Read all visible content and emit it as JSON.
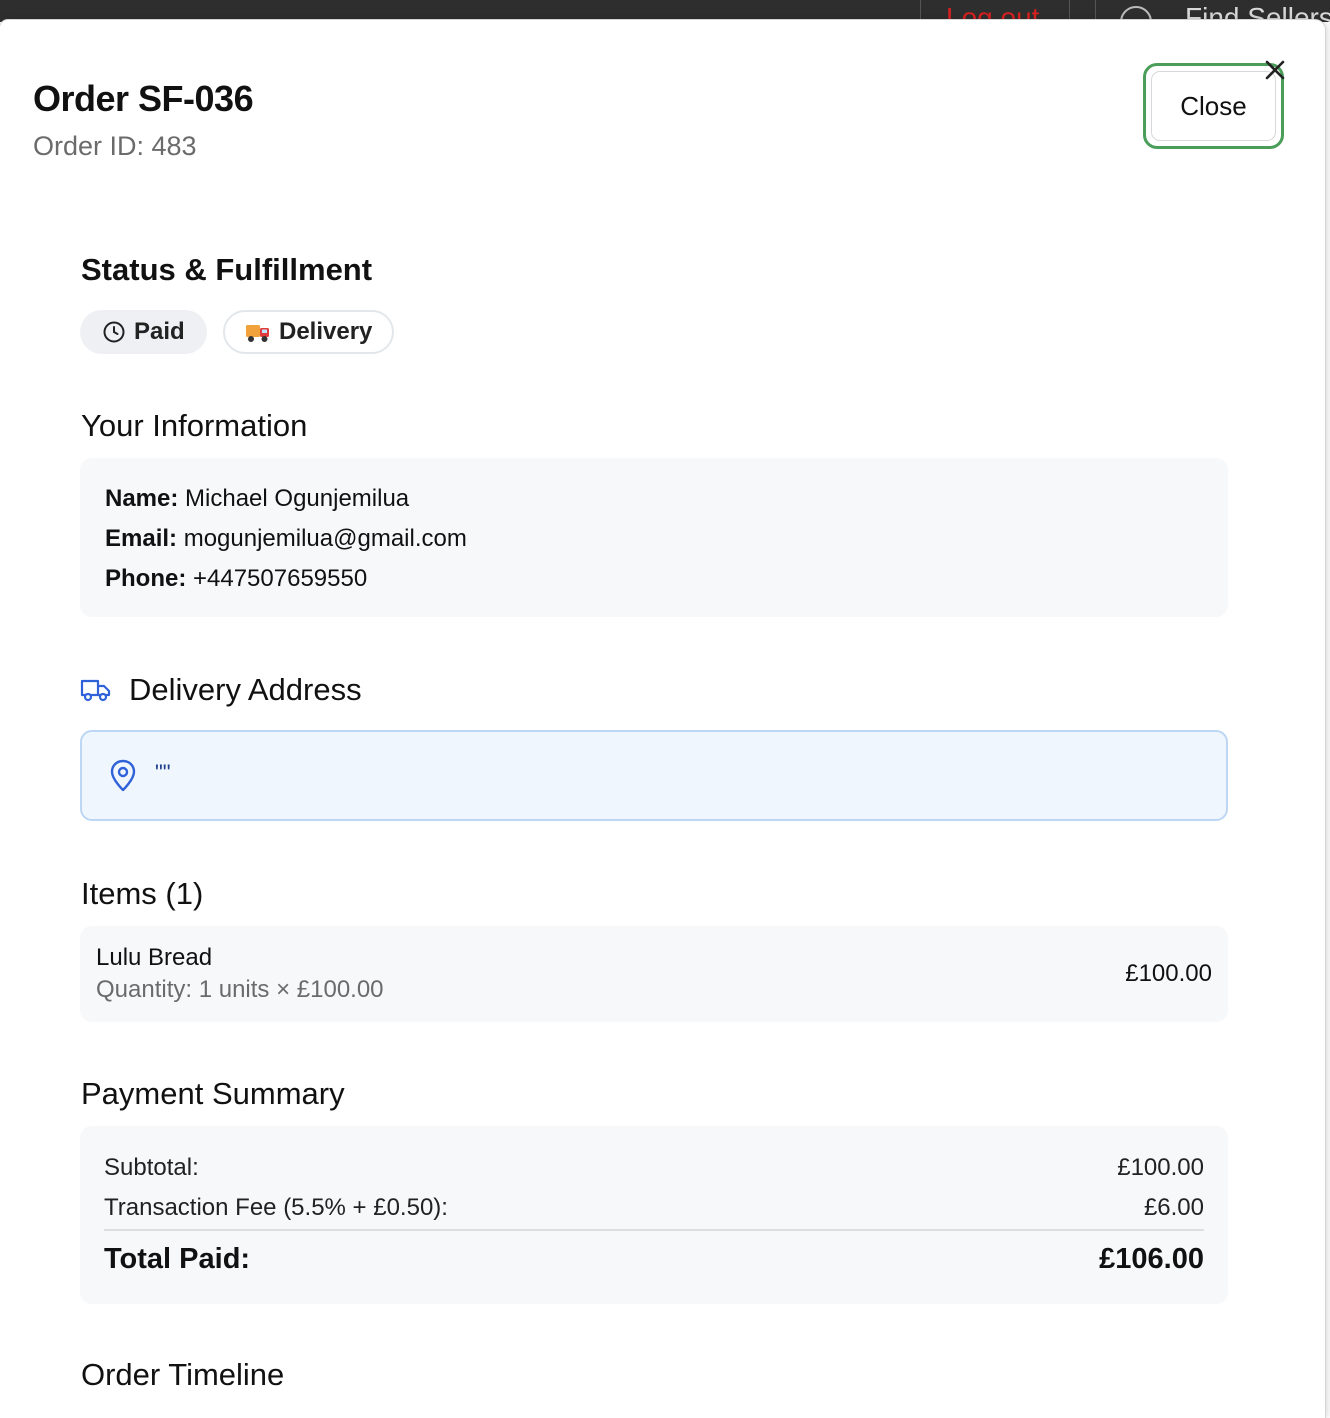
{
  "background_bar": {
    "logout_label": "Log out",
    "search_label": "Find Sellers"
  },
  "modal": {
    "title": "Order SF-036",
    "order_id": "Order ID: 483",
    "close_label": "Close",
    "close_icon": "x-icon"
  },
  "status": {
    "heading": "Status & Fulfillment",
    "payment_badge": "Paid",
    "payment_icon": "clock-icon",
    "fulfillment_badge": "Delivery",
    "fulfillment_icon": "delivery-truck-emoji"
  },
  "your_info": {
    "heading": "Your Information",
    "name_label": "Name:",
    "name_value": "Michael Ogunjemilua",
    "email_label": "Email:",
    "email_value": "mogunjemilua@gmail.com",
    "phone_label": "Phone:",
    "phone_value": "+447507659550"
  },
  "delivery_address": {
    "heading": "Delivery Address",
    "heading_icon": "truck-icon",
    "pin_icon": "map-pin-icon",
    "address": "\"\""
  },
  "items": {
    "heading": "Items (1)",
    "list": [
      {
        "name": "Lulu Bread",
        "quantity_text": "Quantity: 1 units × £100.00",
        "price": "£100.00"
      }
    ]
  },
  "payment_summary": {
    "heading": "Payment Summary",
    "subtotal_label": "Subtotal:",
    "subtotal_value": "£100.00",
    "fee_label": "Transaction Fee (5.5% + £0.50):",
    "fee_value": "£6.00",
    "total_label": "Total Paid:",
    "total_value": "£106.00"
  },
  "timeline": {
    "heading": "Order Timeline"
  },
  "colors": {
    "close_focus_ring": "#4a9e5a",
    "address_bg": "#eff6fe",
    "address_border": "#bcd6f3",
    "icon_blue": "#2f62d8",
    "card_bg": "#f6f8fa"
  }
}
